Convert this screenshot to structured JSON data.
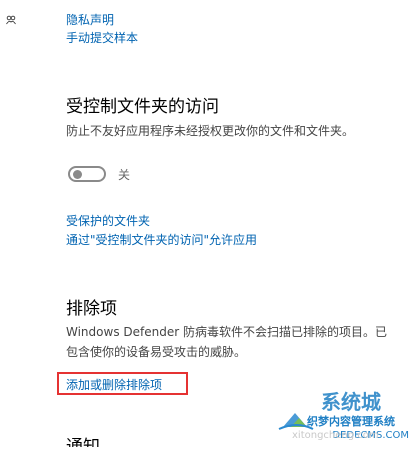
{
  "top_links": {
    "privacy_statement": "隐私声明",
    "manual_submit_sample": "手动提交样本"
  },
  "controlled_folder_access": {
    "title": "受控制文件夹的访问",
    "description": "防止不友好应用程序未经授权更改你的文件和文件夹。",
    "toggle_state_label": "关",
    "toggle_on": false,
    "protected_folders_link": "受保护的文件夹",
    "allow_app_link": "通过\"受控制文件夹的访问\"允许应用"
  },
  "exclusions": {
    "title": "排除项",
    "description_line1": "Windows Defender 防病毒软件不会扫描已排除的项目。已",
    "description_line2": "包含使你的设备易受攻击的威胁。",
    "add_remove_link": "添加或删除排除项"
  },
  "next_section_title_partial": "通知",
  "watermark": {
    "site_name": "系统城",
    "tagline": "织梦内容管理系统",
    "url": "DEDECMS.COM",
    "sub_url": "xitongcheng.com"
  },
  "colors": {
    "link": "#0063b1",
    "highlight": "#e53232"
  },
  "icons": {
    "top_left": "people-icon"
  }
}
